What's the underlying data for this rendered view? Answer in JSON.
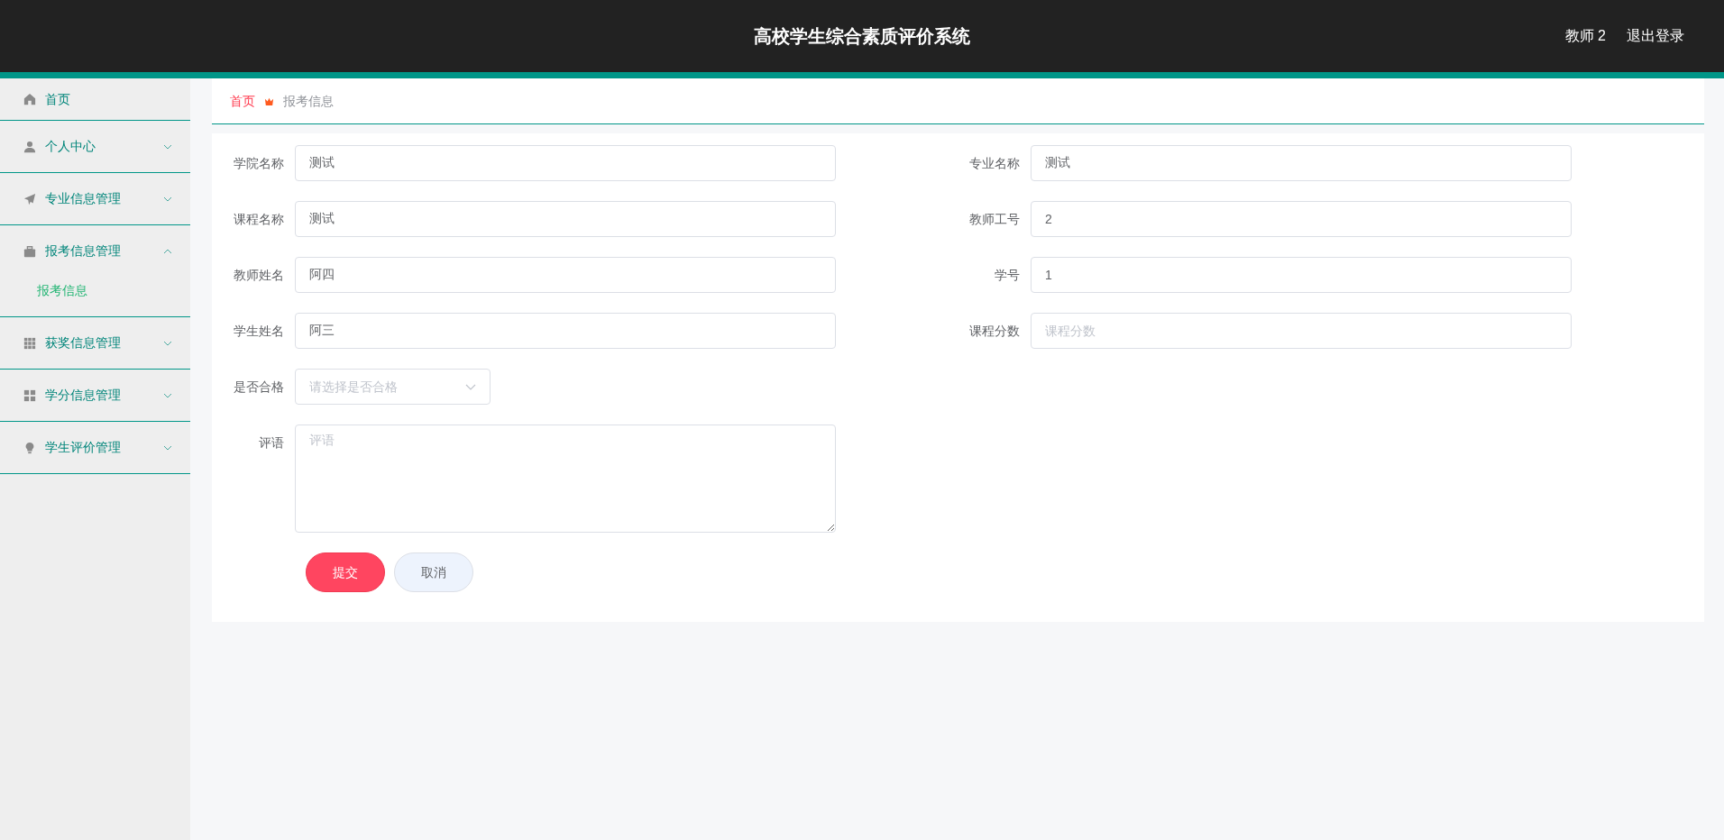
{
  "header": {
    "title": "高校学生综合素质评价系统",
    "user": "教师 2",
    "logout": "退出登录"
  },
  "sidebar": {
    "items": [
      {
        "kind": "link",
        "label": "首页"
      },
      {
        "kind": "group",
        "label": "个人中心",
        "expanded": false
      },
      {
        "kind": "group",
        "label": "专业信息管理",
        "expanded": false
      },
      {
        "kind": "group",
        "label": "报考信息管理",
        "expanded": true,
        "children": [
          {
            "label": "报考信息",
            "selected": true
          }
        ]
      },
      {
        "kind": "group",
        "label": "获奖信息管理",
        "expanded": false
      },
      {
        "kind": "group",
        "label": "学分信息管理",
        "expanded": false
      },
      {
        "kind": "group",
        "label": "学生评价管理",
        "expanded": false
      }
    ]
  },
  "breadcrumb": [
    {
      "label": "首页"
    },
    {
      "label": "报考信息"
    }
  ],
  "form": {
    "fields": [
      {
        "kind": "input",
        "label": "学院名称",
        "value": "测试"
      },
      {
        "kind": "input",
        "label": "专业名称",
        "value": "测试"
      },
      {
        "kind": "input",
        "label": "课程名称",
        "value": "测试"
      },
      {
        "kind": "input",
        "label": "教师工号",
        "value": "2"
      },
      {
        "kind": "input",
        "label": "教师姓名",
        "value": "阿四"
      },
      {
        "kind": "input",
        "label": "学号",
        "value": "1"
      },
      {
        "kind": "input",
        "label": "学生姓名",
        "value": "阿三"
      },
      {
        "kind": "input",
        "label": "课程分数",
        "placeholder": "课程分数"
      },
      {
        "kind": "select",
        "label": "是否合格",
        "placeholder": "请选择是否合格"
      },
      {
        "kind": "textarea",
        "label": "评语",
        "placeholder": "评语"
      }
    ],
    "buttons": [
      {
        "kind": "primary",
        "label": "提交"
      },
      {
        "kind": "secondary",
        "label": "取消"
      }
    ]
  }
}
